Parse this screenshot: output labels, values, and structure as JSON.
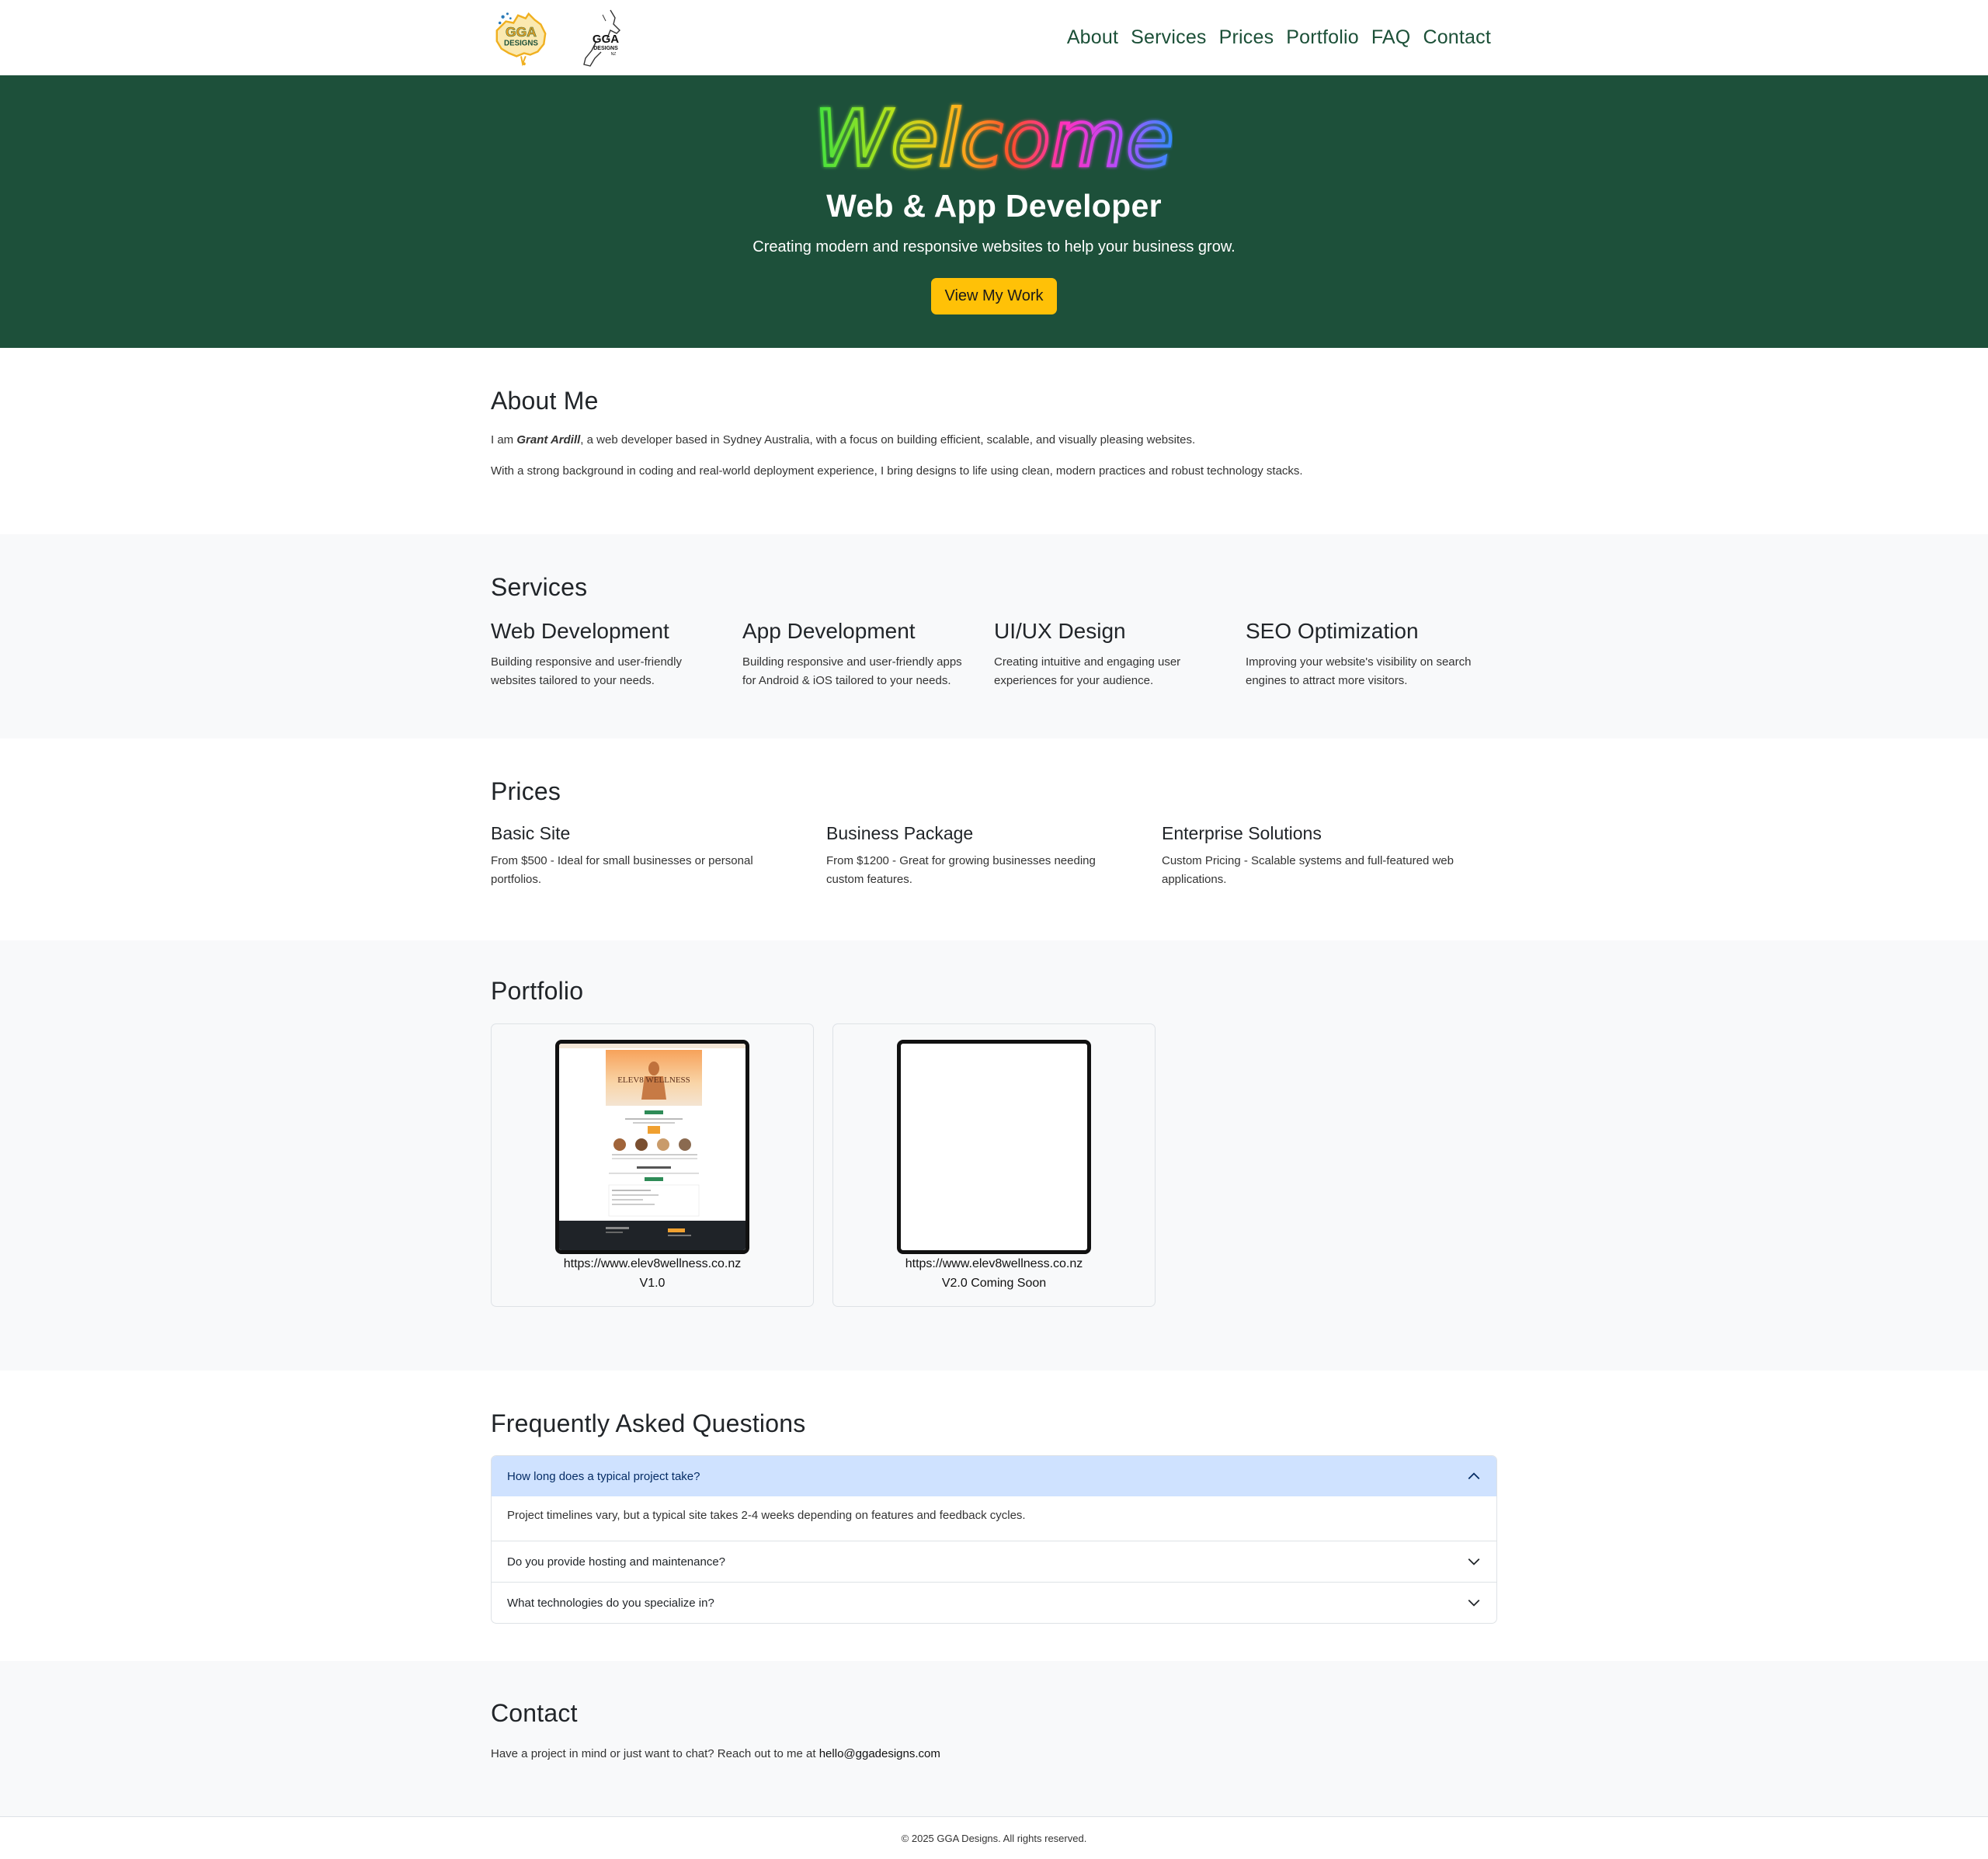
{
  "nav": {
    "links": [
      "About",
      "Services",
      "Prices",
      "Portfolio",
      "FAQ",
      "Contact"
    ],
    "logo_au_text": "GGA",
    "logo_au_sub": "DESIGNS",
    "logo_nz_text": "GGA",
    "logo_nz_sub": "DESIGNS",
    "logo_nz_small": "NZ"
  },
  "hero": {
    "welcome": "Welcome",
    "title": "Web & App Developer",
    "subtitle": "Creating modern and responsive websites to help your business grow.",
    "button": "View My Work",
    "bg": "#1d503a",
    "button_color": "#ffc107"
  },
  "about": {
    "title": "About Me",
    "p1_pre": "I am ",
    "p1_name": "Grant Ardill",
    "p1_post": ", a web developer based in Sydney Australia, with a focus on building efficient, scalable, and visually pleasing websites.",
    "p2": "With a strong background in coding and real-world deployment experience, I bring designs to life using clean, modern practices and robust technology stacks."
  },
  "services": {
    "title": "Services",
    "items": [
      {
        "title": "Web Development",
        "desc": "Building responsive and user-friendly websites tailored to your needs."
      },
      {
        "title": "App Development",
        "desc": "Building responsive and user-friendly apps for Android & iOS tailored to your needs."
      },
      {
        "title": "UI/UX Design",
        "desc": "Creating intuitive and engaging user experiences for your audience."
      },
      {
        "title": "SEO Optimization",
        "desc": "Improving your website's visibility on search engines to attract more visitors."
      }
    ]
  },
  "prices": {
    "title": "Prices",
    "items": [
      {
        "title": "Basic Site",
        "desc": "From $500 - Ideal for small businesses or personal portfolios."
      },
      {
        "title": "Business Package",
        "desc": "From $1200 - Great for growing businesses needing custom features."
      },
      {
        "title": "Enterprise Solutions",
        "desc": "Custom Pricing - Scalable systems and full-featured web applications."
      }
    ]
  },
  "portfolio": {
    "title": "Portfolio",
    "cards": [
      {
        "url": "https://www.elev8wellness.co.nz",
        "version": "V1.0",
        "thumb_title": "ELEV8 WELLNESS"
      },
      {
        "url": "https://www.elev8wellness.co.nz",
        "version": "V2.0 Coming Soon"
      }
    ]
  },
  "faq": {
    "title": "Frequently Asked Questions",
    "items": [
      {
        "q": "How long does a typical project take?",
        "a": "Project timelines vary, but a typical site takes 2-4 weeks depending on features and feedback cycles.",
        "open": true
      },
      {
        "q": "Do you provide hosting and maintenance?",
        "open": false
      },
      {
        "q": "What technologies do you specialize in?",
        "open": false
      }
    ]
  },
  "contact": {
    "title": "Contact",
    "text": "Have a project in mind or just want to chat? Reach out to me at ",
    "email": "hello@ggadesigns.com"
  },
  "footer": {
    "text": "© 2025 GGA Designs. All rights reserved."
  }
}
